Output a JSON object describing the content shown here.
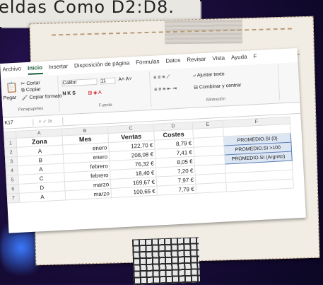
{
  "header_note": {
    "text": "eldas Como D2:D8."
  },
  "ribbon": {
    "tabs": [
      "Archivo",
      "Inicio",
      "Insertar",
      "Disposición de página",
      "Fórmulas",
      "Datos",
      "Revisar",
      "Vista",
      "Ayuda",
      "F"
    ],
    "clipboard": {
      "paste": "Pegar",
      "cut": "Cortar",
      "copy": "Copiar",
      "copy_format": "Copiar formato",
      "label": "Portapapeles"
    },
    "font": {
      "name": "Calibri",
      "size": "11",
      "label": "Fuente"
    },
    "alignment": {
      "wrap": "Ajustar texto",
      "merge": "Combinar y centrar",
      "label": "Alineación"
    }
  },
  "formula_bar": {
    "cell": "K17",
    "fx": "fx"
  },
  "sheet": {
    "columns": [
      "A",
      "B",
      "C",
      "D",
      "E",
      "F"
    ],
    "headers": [
      "Zona",
      "Mes",
      "Ventas",
      "Costes"
    ],
    "rows": [
      {
        "n": "1"
      },
      {
        "n": "2",
        "zona": "A",
        "mes": "enero",
        "ventas": "122,70 €",
        "costes": "8,79 €",
        "f": "PROMEDIO.SI (0)"
      },
      {
        "n": "3",
        "zona": "B",
        "mes": "enero",
        "ventas": "208,08 €",
        "costes": "7,41 €",
        "f": "PROMEDIO.SI >100"
      },
      {
        "n": "4",
        "zona": "A",
        "mes": "febrero",
        "ventas": "76,32 €",
        "costes": "8,05 €",
        "f": "PROMEDIO.SI (Argmto)"
      },
      {
        "n": "5",
        "zona": "C",
        "mes": "febrero",
        "ventas": "18,40 €",
        "costes": "7,20 €"
      },
      {
        "n": "6",
        "zona": "D",
        "mes": "marzo",
        "ventas": "169,67 €",
        "costes": "7,97 €"
      },
      {
        "n": "7",
        "zona": "A",
        "mes": "marzo",
        "ventas": "100,65 €",
        "costes": "7,79 €"
      }
    ]
  }
}
